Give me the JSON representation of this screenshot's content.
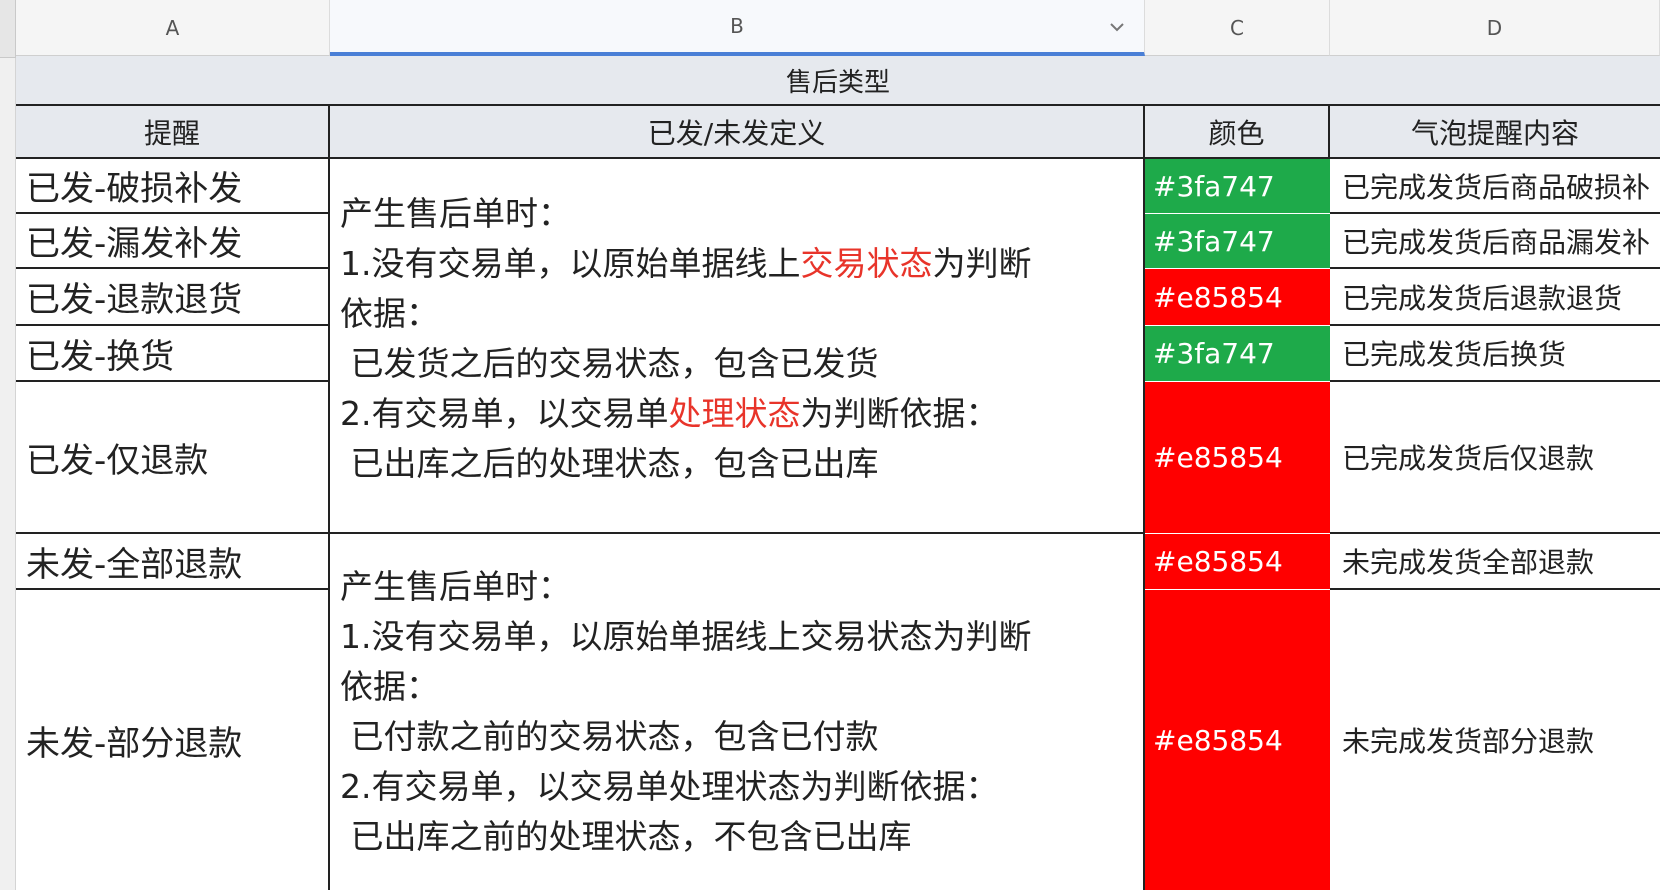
{
  "columns": [
    "A",
    "B",
    "C",
    "D"
  ],
  "section_title": "售后类型",
  "headers": {
    "reminder": "提醒",
    "definition": "已发/未发定义",
    "color": "颜色",
    "bubble": "气泡提醒内容"
  },
  "rows": [
    {
      "reminder": "已发-破损补发",
      "color": "#3fa747",
      "bubble": "已完成发货后商品破损补"
    },
    {
      "reminder": "已发-漏发补发",
      "color": "#3fa747",
      "bubble": "已完成发货后商品漏发补"
    },
    {
      "reminder": "已发-退款退货",
      "color": "#e85854",
      "bubble": "已完成发货后退款退货"
    },
    {
      "reminder": "已发-换货",
      "color": "#3fa747",
      "bubble": "已完成发货后换货"
    },
    {
      "reminder": "已发-仅退款",
      "color": "#e85854",
      "bubble": "已完成发货后仅退款"
    },
    {
      "reminder": "未发-全部退款",
      "color": "#e85854",
      "bubble": "未完成发货全部退款"
    },
    {
      "reminder": "未发-部分退款",
      "color": "#e85854",
      "bubble": "未完成发货部分退款"
    }
  ],
  "definitions": {
    "shipped": {
      "line1": "产生售后单时：",
      "line2_pre": "1.没有交易单，以原始单据线上",
      "line2_hl": "交易状态",
      "line2_post": "为判断",
      "line3": "依据：",
      "line4": " 已发货之后的交易状态，包含已发货",
      "line5_pre": "2.有交易单，以交易单",
      "line5_hl": "处理状态",
      "line5_post": "为判断依据：",
      "line6": " 已出库之后的处理状态，包含已出库"
    },
    "unshipped": {
      "line1": "产生售后单时：",
      "line2": "1.没有交易单，以原始单据线上交易状态为判断",
      "line3": "依据：",
      "line4": " 已付款之前的交易状态，包含已付款",
      "line5": "2.有交易单，以交易单处理状态为判断依据：",
      "line6": " 已出库之前的处理状态，不包含已出库"
    }
  },
  "colors": {
    "green": "#1eaa4a",
    "red": "#ff0000",
    "highlight_text": "#e8342a"
  }
}
